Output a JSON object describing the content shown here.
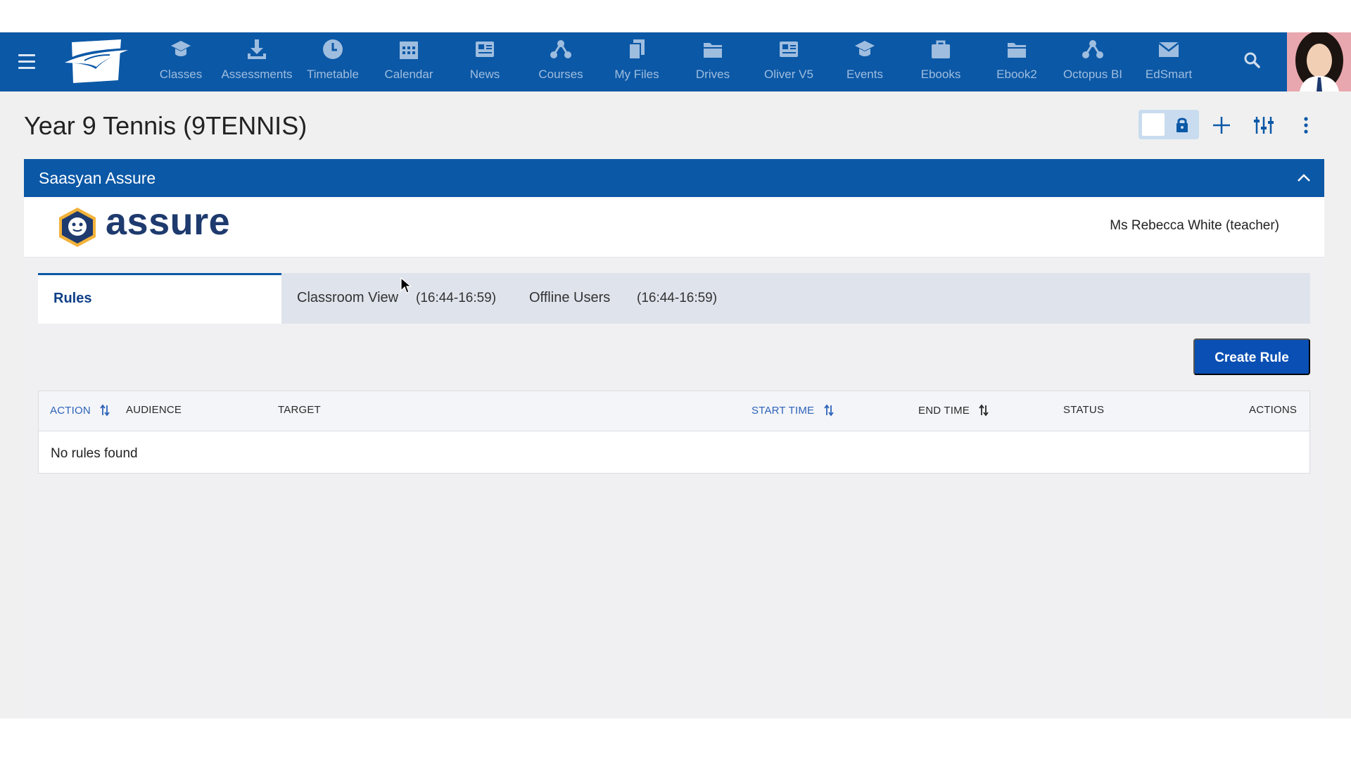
{
  "nav": {
    "items": [
      {
        "label": "Classes",
        "icon": "graduation-cap-icon"
      },
      {
        "label": "Assessments",
        "icon": "download-icon"
      },
      {
        "label": "Timetable",
        "icon": "clock-icon"
      },
      {
        "label": "Calendar",
        "icon": "calendar-icon"
      },
      {
        "label": "News",
        "icon": "newspaper-icon"
      },
      {
        "label": "Courses",
        "icon": "network-icon"
      },
      {
        "label": "My Files",
        "icon": "files-icon"
      },
      {
        "label": "Drives",
        "icon": "folder-icon"
      },
      {
        "label": "Oliver V5",
        "icon": "newspaper-icon"
      },
      {
        "label": "Events",
        "icon": "graduation-cap-icon"
      },
      {
        "label": "Ebooks",
        "icon": "briefcase-icon"
      },
      {
        "label": "Ebook2",
        "icon": "folder-icon"
      },
      {
        "label": "Octopus BI",
        "icon": "network-icon"
      },
      {
        "label": "EdSmart",
        "icon": "envelope-icon"
      }
    ]
  },
  "page": {
    "title": "Year 9 Tennis (9TENNIS)"
  },
  "panel": {
    "title": "Saasyan Assure",
    "brand_name": "assure",
    "user_label": "Ms Rebecca White (teacher)"
  },
  "tabs": [
    {
      "label": "Rules",
      "time": ""
    },
    {
      "label": "Classroom View",
      "time": "(16:44-16:59)"
    },
    {
      "label": "Offline Users",
      "time": "(16:44-16:59)"
    }
  ],
  "create_rule_label": "Create Rule",
  "table": {
    "columns": [
      "ACTION",
      "AUDIENCE",
      "TARGET",
      "START TIME",
      "END TIME",
      "STATUS",
      "ACTIONS"
    ],
    "empty_message": "No rules found"
  },
  "colors": {
    "navbar": "#0b58a6",
    "accent": "#0a4fb3",
    "sortable_header": "#2d63b8"
  }
}
